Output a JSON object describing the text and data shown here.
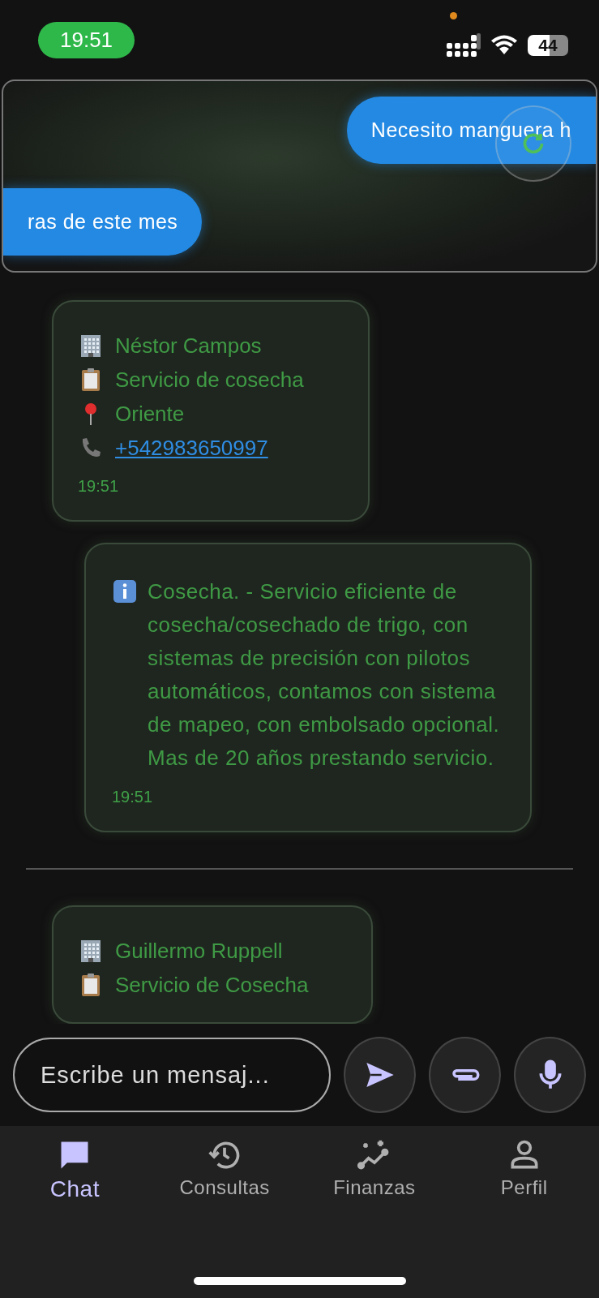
{
  "status_bar": {
    "time": "19:51",
    "battery": "44"
  },
  "suggestions": [
    {
      "text": "Necesito manguera h"
    },
    {
      "text": "ras de este mes"
    }
  ],
  "messages": [
    {
      "kind": "contact",
      "lines": [
        {
          "kind": "company",
          "text": "Néstor Campos"
        },
        {
          "kind": "service",
          "text": "Servicio de cosecha"
        },
        {
          "kind": "location",
          "text": "Oriente"
        },
        {
          "kind": "phone",
          "text": "+542983650997"
        }
      ],
      "time": "19:51"
    },
    {
      "kind": "info",
      "text": "Cosecha. - Servicio eficiente de cosecha/cosechado de trigo, con sistemas de precisión con pilotos automáticos, contamos con sistema de mapeo, con embolsado opcional. Mas de 20 años prestando servicio.",
      "time": "19:51"
    },
    {
      "kind": "divider"
    },
    {
      "kind": "contact",
      "lines": [
        {
          "kind": "company",
          "text": "Guillermo Ruppell"
        },
        {
          "kind": "service",
          "text": "Servicio de Cosecha"
        }
      ]
    }
  ],
  "composer": {
    "placeholder": "Escribe un mensaj..."
  },
  "nav": [
    {
      "label": "Chat",
      "selected": true
    },
    {
      "label": "Consultas",
      "selected": false
    },
    {
      "label": "Finanzas",
      "selected": false
    },
    {
      "label": "Perfil",
      "selected": false
    }
  ]
}
